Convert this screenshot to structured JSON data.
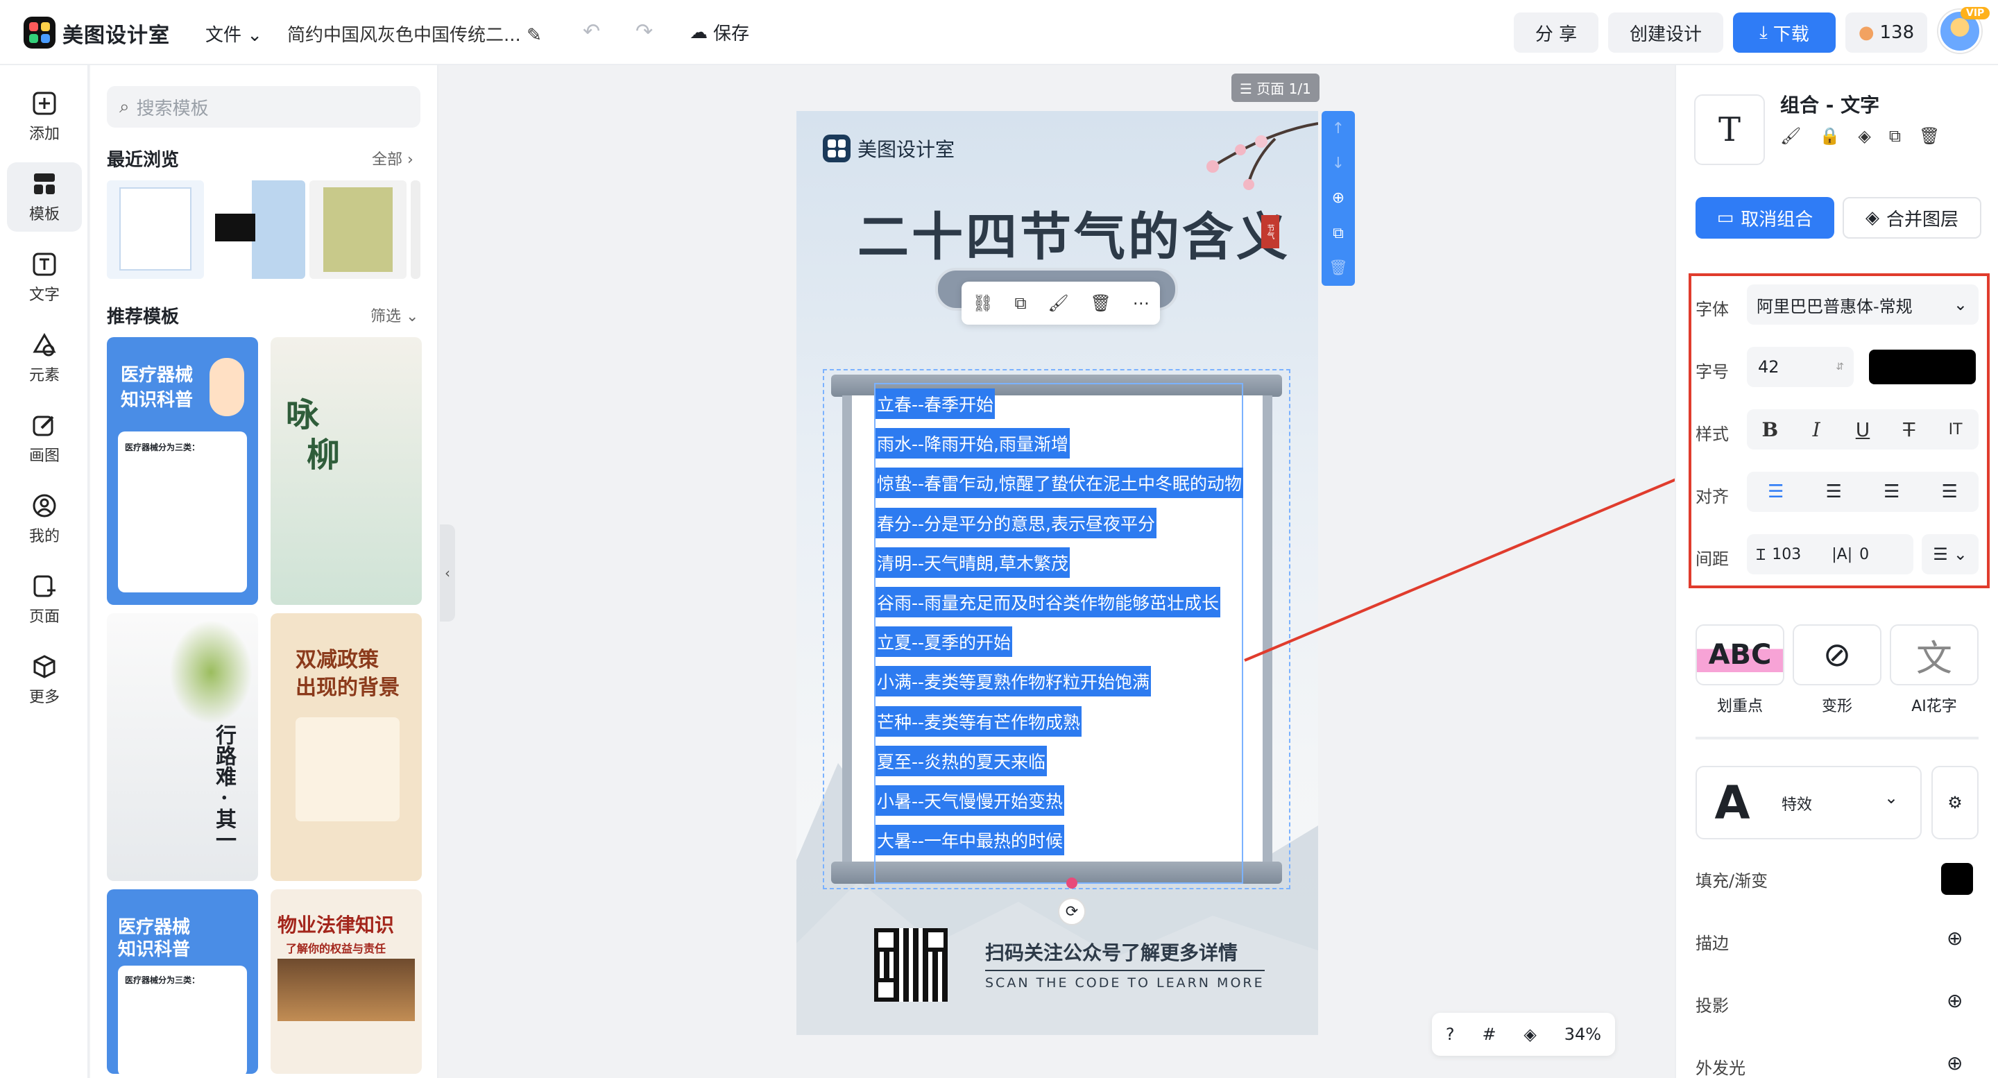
{
  "app": {
    "brand": "美图设计室",
    "file_menu": "文件",
    "doc_title": "简约中国风灰色中国传统二...",
    "save": "保存",
    "share": "分 享",
    "create": "创建设计",
    "download": "下载",
    "coins": "138",
    "vip": "VIP",
    "accent": "#2f7cf6"
  },
  "rail": [
    {
      "label": "添加",
      "icon": "plus-square-icon"
    },
    {
      "label": "模板",
      "icon": "template-grid-icon"
    },
    {
      "label": "文字",
      "icon": "text-icon"
    },
    {
      "label": "元素",
      "icon": "shapes-icon"
    },
    {
      "label": "画图",
      "icon": "pencil-icon"
    },
    {
      "label": "我的",
      "icon": "user-icon"
    },
    {
      "label": "页面",
      "icon": "page-add-icon"
    },
    {
      "label": "更多",
      "icon": "cube-icon"
    }
  ],
  "panel": {
    "search_placeholder": "搜索模板",
    "recent_title": "最近浏览",
    "recent_all": "全部",
    "recommend_title": "推荐模板",
    "filter": "筛选",
    "templates": [
      {
        "title1": "医疗器械",
        "title2": "知识科普",
        "sub": "医疗器械分为三类："
      },
      {
        "title1": "咏",
        "title2": "柳"
      },
      {
        "title1": "行路难 · 其一"
      },
      {
        "title1": "双减政策",
        "title2": "出现的背景"
      },
      {
        "title1": "医疗器械",
        "title2": "知识科普",
        "sub": "医疗器械分为三类："
      },
      {
        "title1": "物业法律知识",
        "title2": "了解你的权益与责任"
      }
    ]
  },
  "canvas": {
    "page_tag": "页面 1/1",
    "poster_brand": "美图设计室",
    "poster_title": "二十四节气的含义",
    "seal": "节气",
    "lines": [
      "立春--春季开始",
      "雨水--降雨开始,雨量渐增",
      "惊蛰--春雷乍动,惊醒了蛰伏在泥土中冬眠的动物",
      "春分--分是平分的意思,表示昼夜平分",
      "清明--天气晴朗,草木繁茂",
      "谷雨--雨量充足而及时谷类作物能够茁壮成长",
      "立夏--夏季的开始",
      "小满--麦类等夏熟作物籽粒开始饱满",
      "芒种--麦类等有芒作物成熟",
      "夏至--炎热的夏天来临",
      "小暑--天气慢慢开始变热",
      "大暑--一年中最热的时候"
    ],
    "scan_cn": "扫码关注公众号了解更多详情",
    "scan_en": "SCAN THE CODE TO LEARN MORE",
    "zoom": "34%"
  },
  "props": {
    "title": "组合 - 文字",
    "ungroup": "取消组合",
    "merge": "合并图层",
    "font_label": "字体",
    "font_value": "阿里巴巴普惠体-常规",
    "size_label": "字号",
    "size_value": "42",
    "color": "#000000",
    "style_label": "样式",
    "align_label": "对齐",
    "spacing_label": "间距",
    "line_spacing": "103",
    "letter_spacing": "0",
    "effects": [
      {
        "label": "划重点",
        "glyph": "ABC"
      },
      {
        "label": "变形",
        "glyph": "⊘"
      },
      {
        "label": "AI花字",
        "glyph": "文"
      }
    ],
    "effect_label": "特效",
    "effect_glyph": "A",
    "fill_label": "填充/渐变",
    "fill_color": "#000000",
    "stroke_label": "描边",
    "shadow_label": "投影",
    "glow_label": "外发光"
  }
}
